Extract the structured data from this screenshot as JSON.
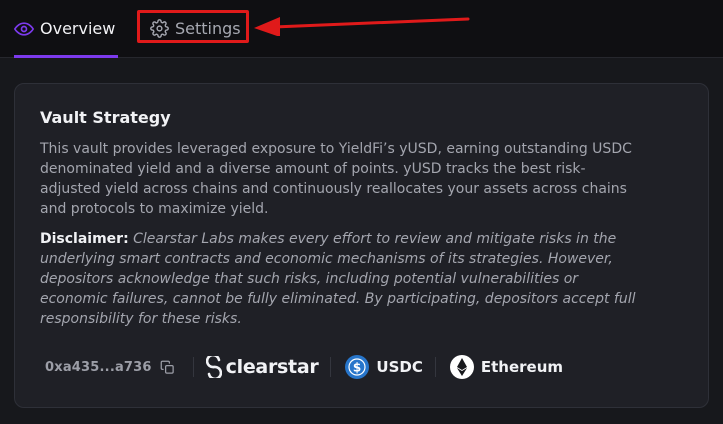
{
  "tabs": {
    "overview_label": "Overview",
    "settings_label": "Settings"
  },
  "card": {
    "title": "Vault Strategy",
    "description": "This vault provides leveraged exposure to YieldFi’s yUSD, earning outstanding USDC denominated yield and a diverse amount of points. yUSD tracks the best risk-adjusted yield across chains and continuously reallocates your assets across chains and protocols to maximize yield.",
    "disclaimer_label": "Disclaimer:",
    "disclaimer_text": "Clearstar Labs makes every effort to review and mitigate risks in the underlying smart contracts and economic mechanisms of its strategies. However, depositors acknowledge that such risks, including potential vulnerabilities or economic failures, cannot be fully eliminated. By participating, depositors accept full responsibility for these risks."
  },
  "meta": {
    "address": "0xa435...a736",
    "curator": "clearstar",
    "asset": "USDC",
    "network": "Ethereum"
  },
  "icons": {
    "overview": "eye-icon",
    "settings": "gear-icon",
    "copy": "copy-icon",
    "curator_logo": "clearstar-logo-icon",
    "asset_logo": "usdc-icon",
    "network_logo": "ethereum-icon"
  },
  "colors": {
    "accent": "#7c3aed",
    "annotation": "#e01a1a",
    "usdc": "#2775ca"
  }
}
